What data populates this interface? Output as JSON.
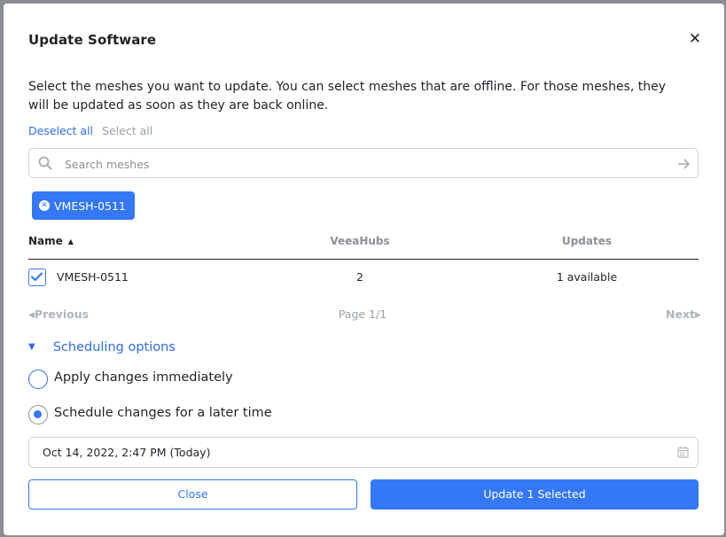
{
  "dialog": {
    "title": "Update Software",
    "close_glyph": "✕",
    "description": "Select the meshes you want to update. You can select meshes that are offline. For those meshes, they will be updated as soon as they are back online."
  },
  "selection": {
    "deselect_all": "Deselect all",
    "select_all": "Select all"
  },
  "search": {
    "placeholder": "Search meshes",
    "value": ""
  },
  "chips": [
    {
      "label": "VMESH-0511"
    }
  ],
  "table": {
    "columns": [
      "Name",
      "VeeaHubs",
      "Updates"
    ],
    "sort_column": "Name",
    "sort_direction": "ascending",
    "rows": [
      {
        "checked": true,
        "name": "VMESH-0511",
        "veeahubs": "2",
        "updates": "1 available"
      }
    ]
  },
  "pagination": {
    "previous": "Previous",
    "page": "Page 1/1",
    "next": "Next"
  },
  "scheduling": {
    "toggle_label": "Scheduling options",
    "options": [
      {
        "label": "Apply changes immediately",
        "selected": false
      },
      {
        "label": "Schedule changes for a later time",
        "selected": true
      }
    ],
    "datetime": "Oct 14, 2022, 2:47 PM (Today)"
  },
  "buttons": {
    "close": "Close",
    "update": "Update 1 Selected"
  },
  "colors": {
    "accent": "#3478f6",
    "link": "#2f6ee6",
    "muted": "#8b9198"
  },
  "icons": [
    "close-icon",
    "search-icon",
    "arrow-right-icon",
    "chip-remove-icon",
    "sort-ascending-icon",
    "checkmark-icon",
    "caret-left-icon",
    "caret-right-icon",
    "caret-down-icon",
    "calendar-icon"
  ]
}
